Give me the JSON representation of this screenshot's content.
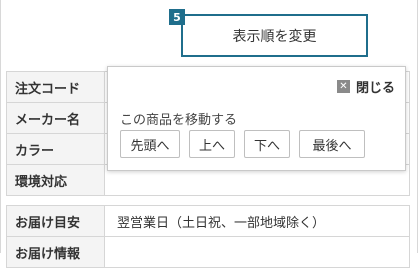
{
  "step_badge": "5",
  "change_order_button": "表示順を変更",
  "table_top": {
    "rows": [
      {
        "label": "注文コード",
        "value": ""
      },
      {
        "label": "メーカー名",
        "value": ""
      },
      {
        "label": "カラー",
        "value": ""
      },
      {
        "label": "環境対応",
        "value": ""
      }
    ]
  },
  "table_bottom": {
    "rows": [
      {
        "label": "お届け目安",
        "value": "翌営業日（土日祝、一部地域除く）"
      },
      {
        "label": "お届け情報",
        "value": ""
      }
    ]
  },
  "popup": {
    "close_label": "閉じる",
    "move_label": "この商品を移動する",
    "buttons": [
      "先頭へ",
      "上へ",
      "下へ",
      "最後へ"
    ]
  }
}
